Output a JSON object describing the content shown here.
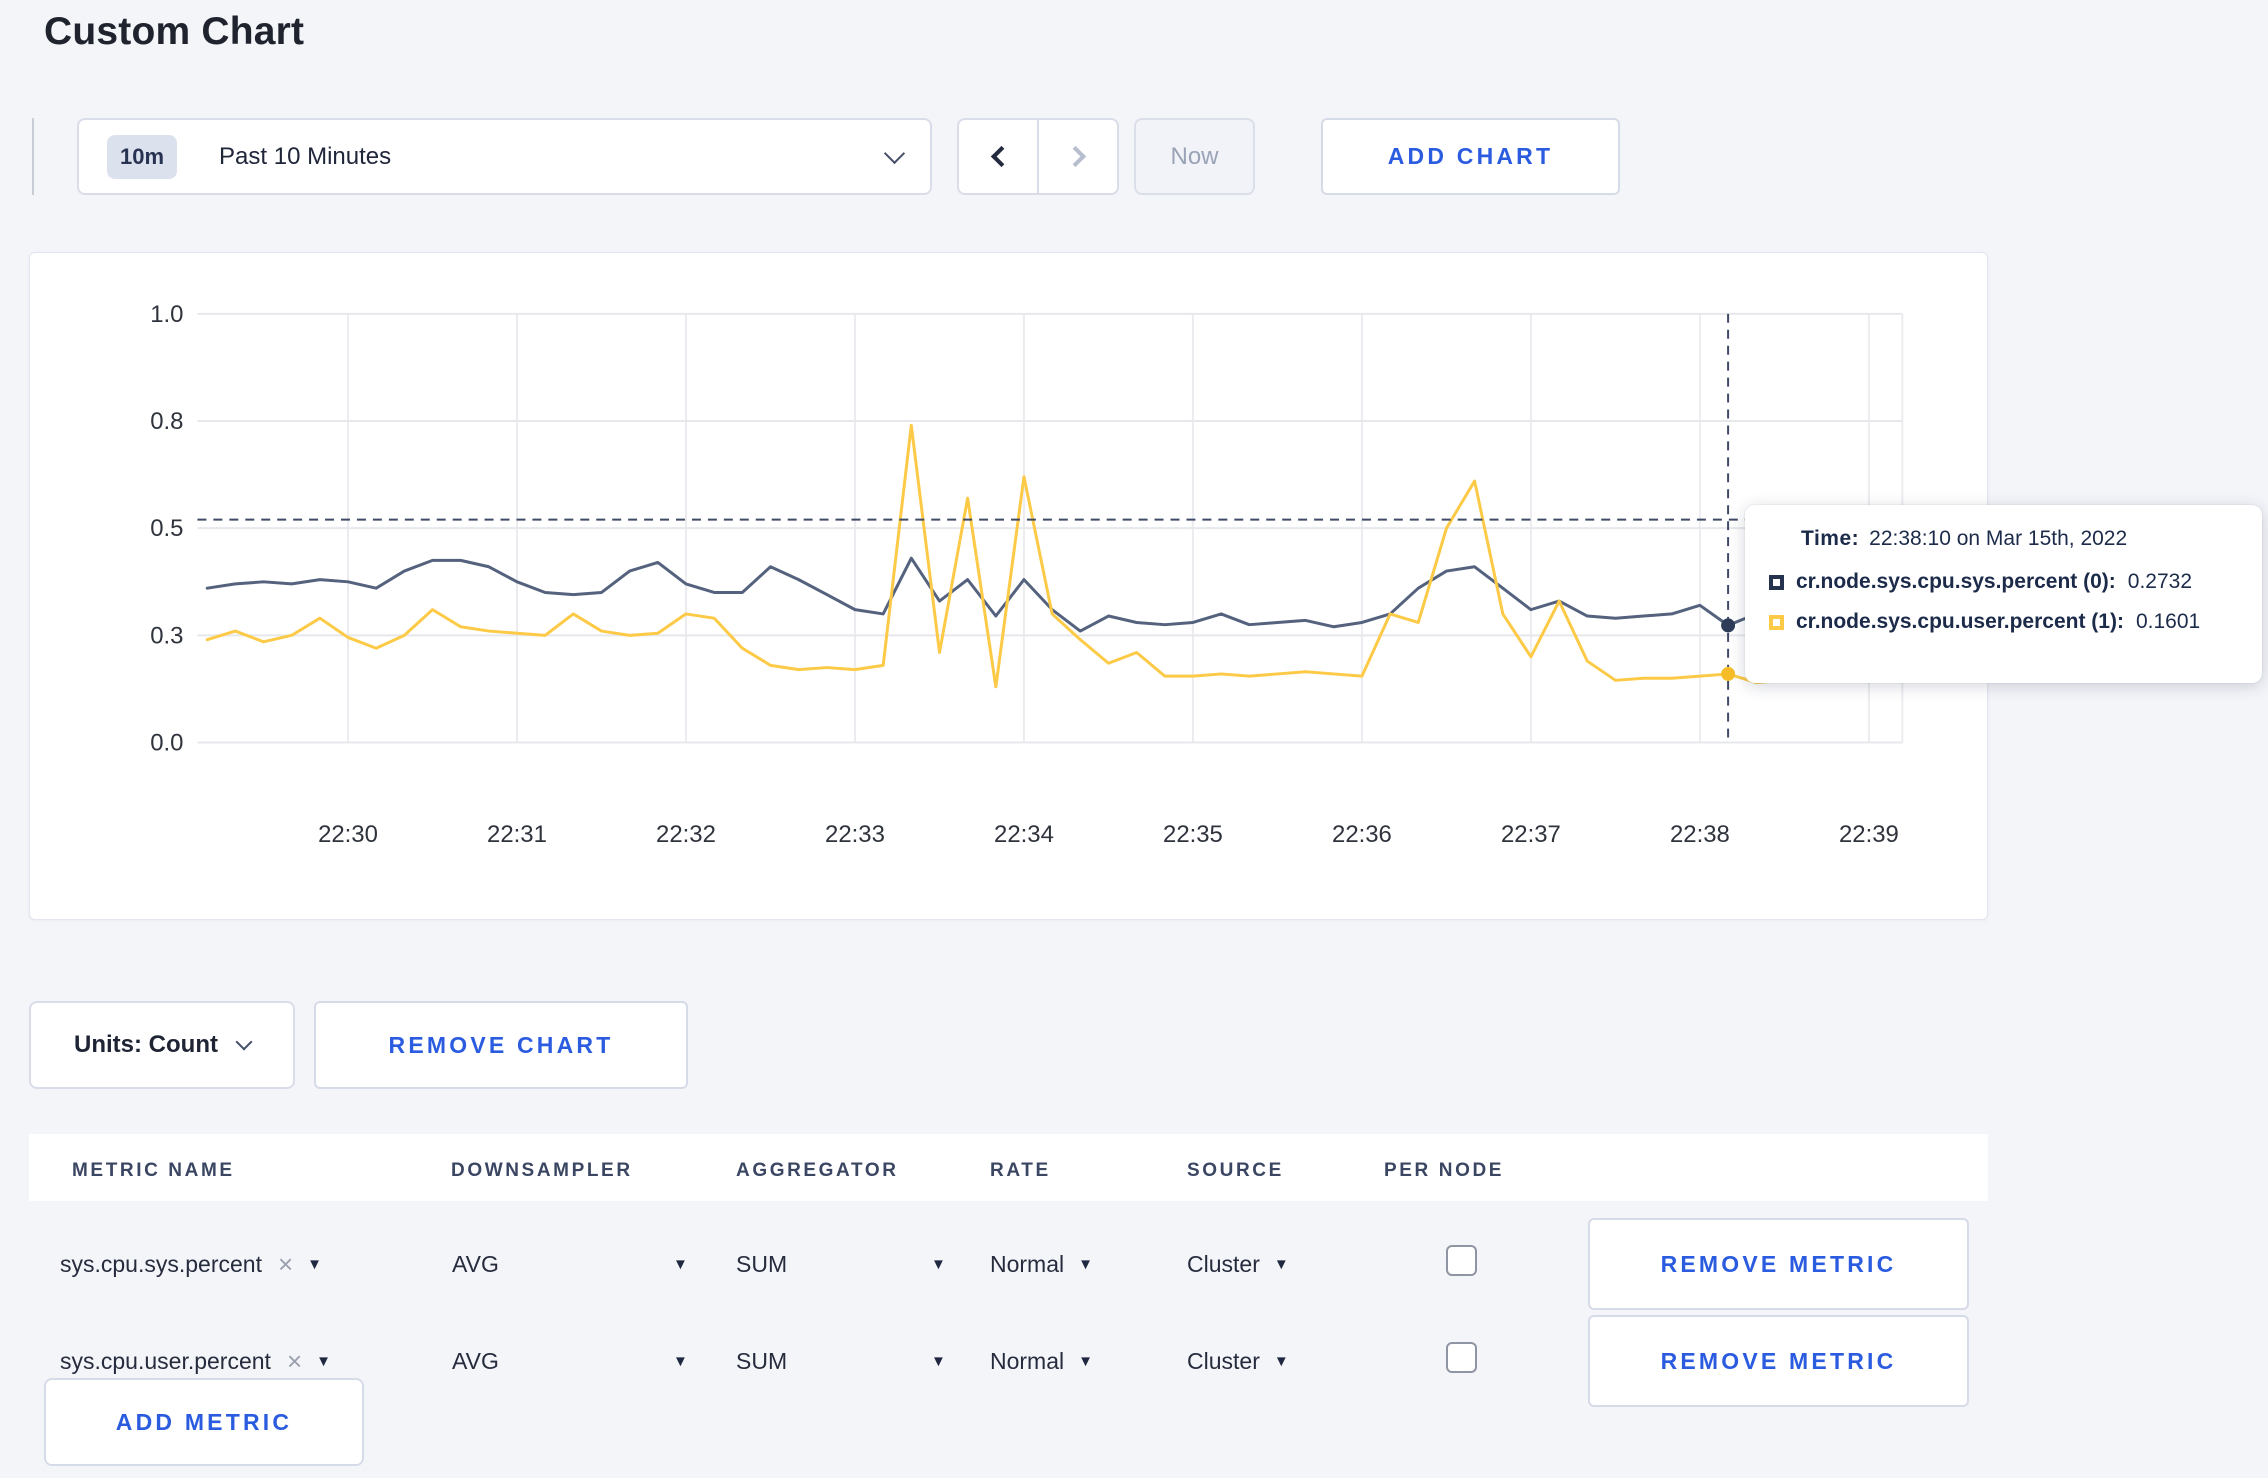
{
  "page": {
    "title": "Custom Chart",
    "background_color": "#f4f5f9",
    "accent_blue": "#2b5ce0"
  },
  "toolbar": {
    "time_scale_badge": "10m",
    "time_scale_label": "Past 10 Minutes",
    "now_label": "Now",
    "add_chart_label": "ADD CHART",
    "icons": [
      "chevron-down-icon",
      "chevron-left-icon",
      "chevron-right-icon"
    ]
  },
  "tooltip": {
    "time_label": "Time:",
    "time_value": "22:38:10 on Mar 15th, 2022",
    "entries": [
      {
        "name": "cr.node.sys.cpu.sys.percent (0):",
        "value": "0.2732",
        "color": "#26334f"
      },
      {
        "name": "cr.node.sys.cpu.user.percent (1):",
        "value": "0.1601",
        "color": "#fcca46"
      }
    ]
  },
  "chart_controls": {
    "units_label": "Units: Count",
    "remove_chart_label": "REMOVE CHART"
  },
  "metrics_table": {
    "headers": {
      "metric": "METRIC NAME",
      "downsampler": "DOWNSAMPLER",
      "aggregator": "AGGREGATOR",
      "rate": "RATE",
      "source": "SOURCE",
      "per_node": "PER NODE"
    },
    "rows": [
      {
        "metric": "sys.cpu.sys.percent",
        "downsampler": "AVG",
        "aggregator": "SUM",
        "rate": "Normal",
        "source": "Cluster",
        "per_node_checked": false,
        "remove_label": "REMOVE METRIC"
      },
      {
        "metric": "sys.cpu.user.percent",
        "downsampler": "AVG",
        "aggregator": "SUM",
        "rate": "Normal",
        "source": "Cluster",
        "per_node_checked": false,
        "remove_label": "REMOVE METRIC"
      }
    ],
    "add_metric_label": "ADD METRIC",
    "row_icons": [
      "close-x-icon",
      "dropdown-caret-icon",
      "checkbox"
    ]
  },
  "chart_data": {
    "type": "line",
    "title": "",
    "xlabel": "",
    "ylabel": "",
    "ylim": [
      0,
      1
    ],
    "grid": true,
    "legend_position": "tooltip",
    "y_ticks": [
      {
        "value": 0,
        "label": "0.0"
      },
      {
        "value": 0.25,
        "label": "0.3"
      },
      {
        "value": 0.5,
        "label": "0.5"
      },
      {
        "value": 0.75,
        "label": "0.8"
      },
      {
        "value": 1,
        "label": "1.0"
      }
    ],
    "x_ticks": [
      "22:30",
      "22:31",
      "22:32",
      "22:33",
      "22:34",
      "22:35",
      "22:36",
      "22:37",
      "22:38",
      "22:39"
    ],
    "x_start": "22:29:10",
    "x_interval_seconds": 10,
    "x_start_offset_minutes": -0.8333,
    "hover_hline_value": 0.52,
    "crosshair": {
      "index": 54,
      "time": "22:38:10"
    },
    "series": [
      {
        "name": "cr.node.sys.cpu.sys.percent",
        "color": "#54627e",
        "dot_color": "#2e3c59",
        "values": [
          0.36,
          0.37,
          0.375,
          0.37,
          0.38,
          0.375,
          0.36,
          0.4,
          0.425,
          0.425,
          0.41,
          0.375,
          0.35,
          0.345,
          0.35,
          0.4,
          0.42,
          0.37,
          0.35,
          0.35,
          0.41,
          0.38,
          0.345,
          0.31,
          0.3,
          0.43,
          0.33,
          0.38,
          0.295,
          0.38,
          0.31,
          0.26,
          0.295,
          0.28,
          0.275,
          0.28,
          0.3,
          0.275,
          0.28,
          0.285,
          0.27,
          0.28,
          0.3,
          0.36,
          0.4,
          0.41,
          0.36,
          0.31,
          0.33,
          0.295,
          0.29,
          0.295,
          0.3,
          0.32,
          0.2732,
          0.3,
          0.3,
          0.31,
          0.3,
          0.31
        ]
      },
      {
        "name": "cr.node.sys.cpu.user.percent",
        "color": "#fcca46",
        "dot_color": "#f7bd29",
        "values": [
          0.24,
          0.26,
          0.235,
          0.25,
          0.29,
          0.245,
          0.22,
          0.25,
          0.31,
          0.27,
          0.26,
          0.255,
          0.25,
          0.3,
          0.26,
          0.25,
          0.255,
          0.3,
          0.29,
          0.22,
          0.18,
          0.17,
          0.175,
          0.17,
          0.18,
          0.74,
          0.21,
          0.57,
          0.13,
          0.62,
          0.3,
          0.24,
          0.185,
          0.21,
          0.155,
          0.155,
          0.16,
          0.155,
          0.16,
          0.165,
          0.16,
          0.155,
          0.3,
          0.28,
          0.5,
          0.61,
          0.3,
          0.2,
          0.33,
          0.19,
          0.145,
          0.15,
          0.15,
          0.155,
          0.1601,
          0.14,
          0.145,
          0.15,
          0.31,
          0.26
        ]
      }
    ]
  }
}
